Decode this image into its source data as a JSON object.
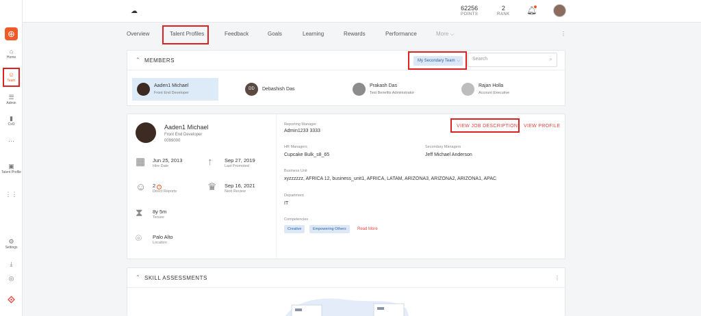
{
  "sidebar": {
    "logo_icon": "plus-circle-icon",
    "items": [
      {
        "label": "Home",
        "icon": "home-icon"
      },
      {
        "label": "Team",
        "icon": "team-icon",
        "active": true
      },
      {
        "label": "Admin",
        "icon": "admin-icon"
      },
      {
        "label": "CxO",
        "icon": "chart-icon"
      },
      {
        "label": "",
        "icon": "more-dots-icon"
      },
      {
        "label": "Talent Profile",
        "icon": "profile-card-icon"
      },
      {
        "label": "",
        "icon": "apps-grid-icon"
      },
      {
        "label": "Settings",
        "icon": "gear-icon"
      },
      {
        "label": "",
        "icon": "download-icon"
      },
      {
        "label": "",
        "icon": "help-icon"
      }
    ]
  },
  "header": {
    "points_value": "62256",
    "points_label": "POINTS",
    "rank_value": "2",
    "rank_label": "RANK"
  },
  "tabs": [
    {
      "label": "Overview"
    },
    {
      "label": "Talent Profiles",
      "active": true
    },
    {
      "label": "Feedback"
    },
    {
      "label": "Goals"
    },
    {
      "label": "Learning"
    },
    {
      "label": "Rewards"
    },
    {
      "label": "Performance"
    },
    {
      "label": "More ⌵"
    }
  ],
  "members_card": {
    "title": "MEMBERS",
    "team_select": "My Secondary Team",
    "search_placeholder": "Search",
    "members": [
      {
        "name": "Aaden1 Michael",
        "role": "Front End Developer",
        "initials": "",
        "selected": true
      },
      {
        "name": "Debashish Das",
        "role": "",
        "initials": "DD"
      },
      {
        "name": "Prakash Das",
        "role": "Test Benefits Administrator",
        "initials": ""
      },
      {
        "name": "Rajan Holla",
        "role": "Account Executive",
        "initials": ""
      }
    ]
  },
  "profile": {
    "name": "Aaden1 Michael",
    "role": "Front End Developer",
    "employee_id": "0099000",
    "facts": {
      "hire_date": {
        "value": "Jun 25, 2013",
        "caption": "Hire Date"
      },
      "last_promoted": {
        "value": "Sep 27, 2019",
        "caption": "Last Promoted"
      },
      "direct_reports": {
        "value": "2",
        "caption": "Direct Reports"
      },
      "next_review": {
        "value": "Sep 16, 2021",
        "caption": "Next Review"
      },
      "tenure": {
        "value": "8y 5m",
        "caption": "Tenure"
      },
      "location": {
        "value": "Palo Alto",
        "caption": "Location"
      }
    },
    "reporting_manager_label": "Reporting Manager",
    "reporting_manager": "Admin1233 3333",
    "view_job_description": "VIEW JOB DESCRIPTION",
    "view_profile": "VIEW PROFILE",
    "hr_managers_label": "HR Managers",
    "hr_managers": "Cupcake Bulk_s8_65",
    "secondary_managers_label": "Secondary Managers",
    "secondary_managers": "Jeff Michael Anderson",
    "business_unit_label": "Business Unit",
    "business_unit": "xyzzzzzz, AFRICA 12, business_unit1, AFRICA, LATAM, ARIZONA3, ARIZONA2, ARIZONA1, APAC",
    "department_label": "Department",
    "department": "IT",
    "competencies_label": "Competencies",
    "competencies": [
      "Creative",
      "Empowering Others"
    ],
    "read_more": "Read More"
  },
  "skill_card": {
    "title": "SKILL ASSESSMENTS"
  },
  "colors": {
    "accent": "#f05a28",
    "link_red": "#e8453c",
    "chip_bg": "#dde8f7",
    "chip_text": "#2d5fa8",
    "highlight_box": "#e02020"
  }
}
